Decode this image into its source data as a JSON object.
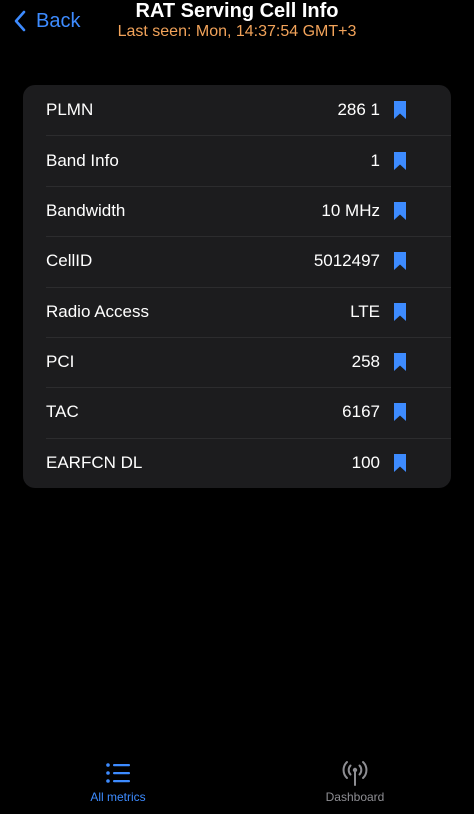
{
  "header": {
    "back_label": "Back",
    "title": "RAT Serving Cell Info",
    "subtitle": "Last seen: Mon, 14:37:54 GMT+3"
  },
  "rows": [
    {
      "label": "PLMN",
      "value": "286 1"
    },
    {
      "label": "Band Info",
      "value": "1"
    },
    {
      "label": "Bandwidth",
      "value": "10 MHz"
    },
    {
      "label": "CellID",
      "value": "5012497"
    },
    {
      "label": "Radio Access",
      "value": "LTE"
    },
    {
      "label": "PCI",
      "value": "258"
    },
    {
      "label": "TAC",
      "value": "6167"
    },
    {
      "label": "EARFCN DL",
      "value": "100"
    }
  ],
  "tabs": [
    {
      "label": "All metrics",
      "icon": "list-icon",
      "active": true
    },
    {
      "label": "Dashboard",
      "icon": "antenna-icon",
      "active": false
    }
  ],
  "colors": {
    "accent": "#3d8bff",
    "subtitle": "#f2a35a",
    "card": "#1c1c1e",
    "background": "#000000"
  }
}
